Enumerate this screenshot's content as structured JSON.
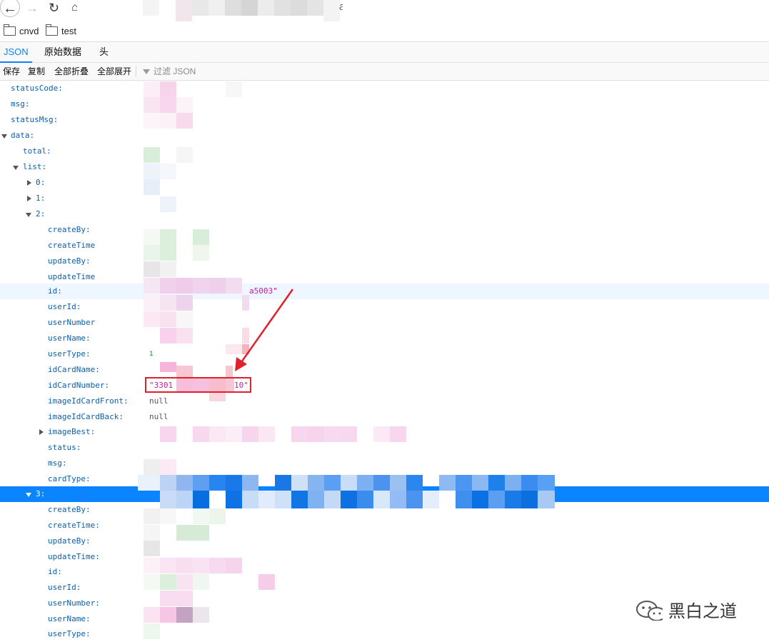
{
  "browser": {
    "url_fragment": "anual",
    "bookmarks": [
      {
        "label": "cnvd"
      },
      {
        "label": "test"
      }
    ]
  },
  "viewer": {
    "tabs": [
      {
        "label": "JSON"
      },
      {
        "label": "原始数据"
      },
      {
        "label": "头"
      }
    ],
    "toolbar": {
      "save": "保存",
      "copy": "复制",
      "collapse_all": "全部折叠",
      "expand_all": "全部展开",
      "filter_placeholder": "过滤 JSON"
    }
  },
  "tree": {
    "keys": {
      "statusCode": "statusCode:",
      "msg": "msg:",
      "statusMsg": "statusMsg:",
      "data": "data:",
      "total": "total:",
      "list": "list:",
      "item0": "0:",
      "item1": "1:",
      "item2": "2:",
      "item3": "3:"
    },
    "item2_fields": [
      {
        "key": "createBy:",
        "value": ""
      },
      {
        "key": "createTime",
        "value": ""
      },
      {
        "key": "updateBy:",
        "value": ""
      },
      {
        "key": "updateTime",
        "value": ""
      },
      {
        "key": "id:",
        "value": "a5003\""
      },
      {
        "key": "userId:",
        "value": ""
      },
      {
        "key": "userNumber",
        "value": ""
      },
      {
        "key": "userName:",
        "value": ""
      },
      {
        "key": "userType:",
        "value": "1"
      },
      {
        "key": "idCardName:",
        "value": ""
      },
      {
        "key": "idCardNumber:",
        "value_start": "\"3301",
        "value_end": "10\""
      },
      {
        "key": "imageIdCardFront:",
        "value": "null"
      },
      {
        "key": "imageIdCardBack:",
        "value": "null"
      },
      {
        "key": "imageBest:",
        "value": ""
      },
      {
        "key": "status:",
        "value": ""
      },
      {
        "key": "msg:",
        "value": ""
      },
      {
        "key": "cardType:",
        "value": ""
      }
    ],
    "item3_fields": [
      {
        "key": "createBy:"
      },
      {
        "key": "createTime:"
      },
      {
        "key": "updateBy:"
      },
      {
        "key": "updateTime:"
      },
      {
        "key": "id:"
      },
      {
        "key": "userId:"
      },
      {
        "key": "userNumber:"
      },
      {
        "key": "userName:"
      },
      {
        "key": "userType:"
      }
    ]
  },
  "watermark": {
    "text": "黑白之道"
  },
  "colors": {
    "key_blue": "#0b5fad",
    "string_magenta": "#c81e9e",
    "selection_blue": "#0a84ff",
    "annotation_red": "#e0202a"
  }
}
